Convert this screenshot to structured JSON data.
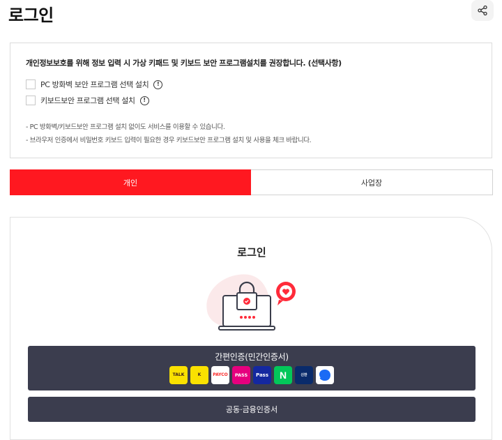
{
  "page": {
    "title": "로그인"
  },
  "share": {
    "icon": "share-icon"
  },
  "notice": {
    "heading": "개인정보보호를 위해 정보 입력 시 가상 키패드 및 키보드 보안 프로그램설치를 권장합니다. (선택사항)",
    "options": [
      {
        "label": "PC 방화벽 보안 프로그램 선택 설치",
        "checked": false
      },
      {
        "label": "키보드보안 프로그램 선택 설치",
        "checked": false
      }
    ],
    "info_icon": "!",
    "notes": [
      "- PC 방화벽/키보드보안 프로그램 설치 없이도 서비스를 이용할 수 있습니다.",
      "- 브라우저 인증에서 비밀번호 키보드 입력이 필요한 경우 키보드보안 프로그램 설치 및 사용을 체크 바랍니다."
    ]
  },
  "tabs": [
    {
      "label": "개인",
      "active": true
    },
    {
      "label": "사업장",
      "active": false
    }
  ],
  "login": {
    "title": "로그인",
    "simple_auth_label": "간편인증(민간인증서)",
    "providers": [
      {
        "name": "kakaotalk",
        "text": "TALK"
      },
      {
        "name": "kakaobank",
        "text": "K"
      },
      {
        "name": "payco",
        "text": "PAYCO"
      },
      {
        "name": "pass",
        "text": "PASS"
      },
      {
        "name": "samsung-pass",
        "text": "Pass"
      },
      {
        "name": "naver",
        "text": "N"
      },
      {
        "name": "shinhan",
        "text": "신한"
      },
      {
        "name": "toss",
        "text": ""
      }
    ],
    "cert_label": "공동·금융인증서"
  },
  "colors": {
    "accent": "#ff1820",
    "button_dark": "#3b3d4e",
    "illustration_pink": "#fbe9ea"
  }
}
